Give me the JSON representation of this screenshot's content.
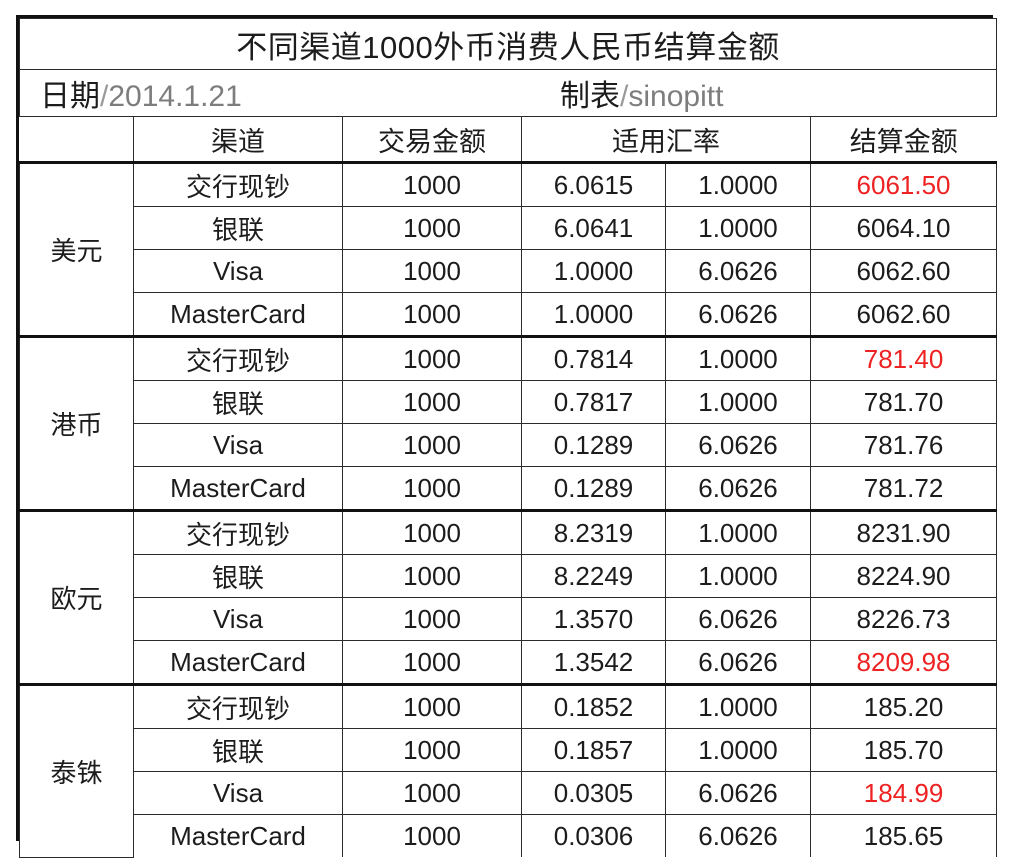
{
  "document": {
    "title": "不同渠道1000外币消费人民币结算金额",
    "date_label": "日期",
    "date_value": "2014.1.21",
    "author_label": "制表",
    "author_value": "sinopitt",
    "separator": "/",
    "highlight_color": "#ee2222"
  },
  "table": {
    "headers": {
      "currency": "",
      "channel": "渠道",
      "amount": "交易金额",
      "rate": "适用汇率",
      "settlement": "结算金额"
    },
    "groups": [
      {
        "currency": "美元",
        "rows": [
          {
            "channel": "交行现钞",
            "amount": "1000",
            "rate1": "6.0615",
            "rate2": "1.0000",
            "settlement": "6061.50",
            "highlight": true
          },
          {
            "channel": "银联",
            "amount": "1000",
            "rate1": "6.0641",
            "rate2": "1.0000",
            "settlement": "6064.10",
            "highlight": false
          },
          {
            "channel": "Visa",
            "amount": "1000",
            "rate1": "1.0000",
            "rate2": "6.0626",
            "settlement": "6062.60",
            "highlight": false
          },
          {
            "channel": "MasterCard",
            "amount": "1000",
            "rate1": "1.0000",
            "rate2": "6.0626",
            "settlement": "6062.60",
            "highlight": false
          }
        ]
      },
      {
        "currency": "港币",
        "rows": [
          {
            "channel": "交行现钞",
            "amount": "1000",
            "rate1": "0.7814",
            "rate2": "1.0000",
            "settlement": "781.40",
            "highlight": true
          },
          {
            "channel": "银联",
            "amount": "1000",
            "rate1": "0.7817",
            "rate2": "1.0000",
            "settlement": "781.70",
            "highlight": false
          },
          {
            "channel": "Visa",
            "amount": "1000",
            "rate1": "0.1289",
            "rate2": "6.0626",
            "settlement": "781.76",
            "highlight": false
          },
          {
            "channel": "MasterCard",
            "amount": "1000",
            "rate1": "0.1289",
            "rate2": "6.0626",
            "settlement": "781.72",
            "highlight": false
          }
        ]
      },
      {
        "currency": "欧元",
        "rows": [
          {
            "channel": "交行现钞",
            "amount": "1000",
            "rate1": "8.2319",
            "rate2": "1.0000",
            "settlement": "8231.90",
            "highlight": false
          },
          {
            "channel": "银联",
            "amount": "1000",
            "rate1": "8.2249",
            "rate2": "1.0000",
            "settlement": "8224.90",
            "highlight": false
          },
          {
            "channel": "Visa",
            "amount": "1000",
            "rate1": "1.3570",
            "rate2": "6.0626",
            "settlement": "8226.73",
            "highlight": false
          },
          {
            "channel": "MasterCard",
            "amount": "1000",
            "rate1": "1.3542",
            "rate2": "6.0626",
            "settlement": "8209.98",
            "highlight": true
          }
        ]
      },
      {
        "currency": "泰铢",
        "rows": [
          {
            "channel": "交行现钞",
            "amount": "1000",
            "rate1": "0.1852",
            "rate2": "1.0000",
            "settlement": "185.20",
            "highlight": false
          },
          {
            "channel": "银联",
            "amount": "1000",
            "rate1": "0.1857",
            "rate2": "1.0000",
            "settlement": "185.70",
            "highlight": false
          },
          {
            "channel": "Visa",
            "amount": "1000",
            "rate1": "0.0305",
            "rate2": "6.0626",
            "settlement": "184.99",
            "highlight": true
          },
          {
            "channel": "MasterCard",
            "amount": "1000",
            "rate1": "0.0306",
            "rate2": "6.0626",
            "settlement": "185.65",
            "highlight": false
          }
        ]
      }
    ]
  }
}
